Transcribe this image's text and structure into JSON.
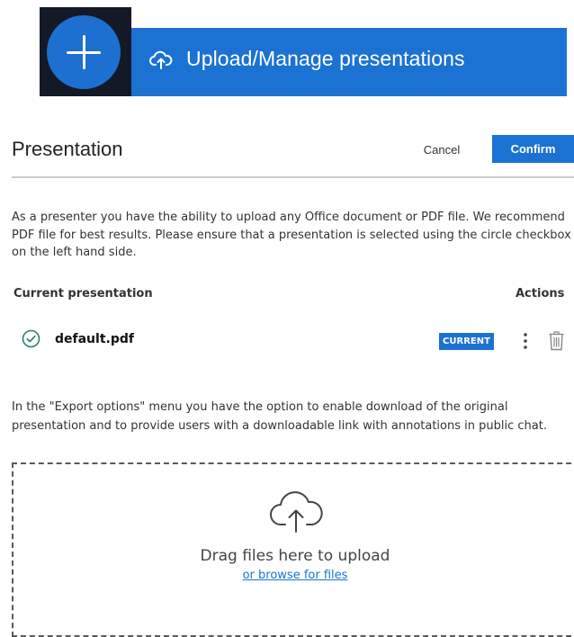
{
  "banner": {
    "label": "Upload/Manage presentations",
    "plus_icon": "plus-icon",
    "cloud_icon": "cloud-upload-icon"
  },
  "header": {
    "title": "Presentation",
    "cancel_label": "Cancel",
    "confirm_label": "Confirm"
  },
  "description": "As a presenter you have the ability to upload any Office document or PDF file. We recommend PDF file for best results. Please ensure that a presentation is selected using the circle checkbox on the left hand side.",
  "table": {
    "col_current": "Current presentation",
    "col_actions": "Actions",
    "rows": [
      {
        "filename": "default.pdf",
        "badge": "CURRENT",
        "selected": true
      }
    ]
  },
  "export_note": "In the \"Export options\" menu you have the option to enable download of the original presentation and to provide users with a downloadable link with annotations in public chat.",
  "dropzone": {
    "drag_text": "Drag files here to upload",
    "browse_text": "or browse for files",
    "icon": "cloud-upload-icon"
  },
  "colors": {
    "accent": "#1b72d2",
    "dark_box": "#141927",
    "divider": "#c8ccd0"
  }
}
